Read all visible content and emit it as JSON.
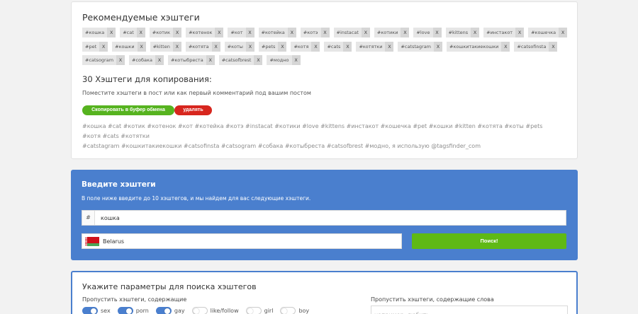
{
  "recommended": {
    "title": "Рекомендуемые хэштеги",
    "close_label": "X",
    "rows": [
      [
        "#кошка",
        "#cat",
        "#котик",
        "#котенок",
        "#кот",
        "#котейка",
        "#котэ",
        "#instacat",
        "#котики",
        "#love",
        "#kittens",
        "#инстакот",
        "#кошечка"
      ],
      [
        "#pet",
        "#кошки",
        "#kitten",
        "#котята",
        "#коты",
        "#pets",
        "#котя",
        "#cats",
        "#котятки",
        "#catstagram",
        "#кошкитакиекошки",
        "#catsofinsta"
      ],
      [
        "#catsogram",
        "#собака",
        "#котыбреста",
        "#catsofbrest",
        "#модно"
      ]
    ]
  },
  "copy": {
    "title": "30 Хэштеги для копирования:",
    "instruction": "Поместите хэштеги в пост или как первый комментарий под вашим постом",
    "copy_button": "Скопировать в буфер обмена",
    "delete_button": "удалять",
    "text_line1": "#кошка #cat #котик #котенок #кот #котейка #котэ #instacat #котики #love #kittens #инстакот #кошечка #pet #кошки #kitten #котята #коты #pets #котя #cats #котятки",
    "text_line2": "#catstagram #кошкитакиекошки #catsofinsta #catsogram #собака #котыбреста #catsofbrest #модно, я использую @tagsfinder_com"
  },
  "enter": {
    "title": "Введите хэштеги",
    "subtitle": "В поле ниже введите до 10 хэштегов, и мы найдем для вас следующие хэштеги.",
    "prefix": "#",
    "value": "кошка",
    "country": "Belarus",
    "search_button": "Поиск!"
  },
  "params": {
    "title": "Укажите параметры для поиска хэштегов",
    "skip_contains": "Пропустить хэштеги, содержащие",
    "skip_words": "Пропустить хэштеги, содержащие слова",
    "word_placeholder": "например, любить",
    "toggles": [
      {
        "label": "sex",
        "on": true
      },
      {
        "label": "porn",
        "on": true
      },
      {
        "label": "gay",
        "on": true
      },
      {
        "label": "like/follow",
        "on": false
      },
      {
        "label": "girl",
        "on": false
      },
      {
        "label": "boy",
        "on": false
      }
    ]
  },
  "colors": {
    "accent_blue": "#4a7fce",
    "copy_green": "#56b31f",
    "delete_red": "#d7261e",
    "search_green": "#5fb915"
  }
}
